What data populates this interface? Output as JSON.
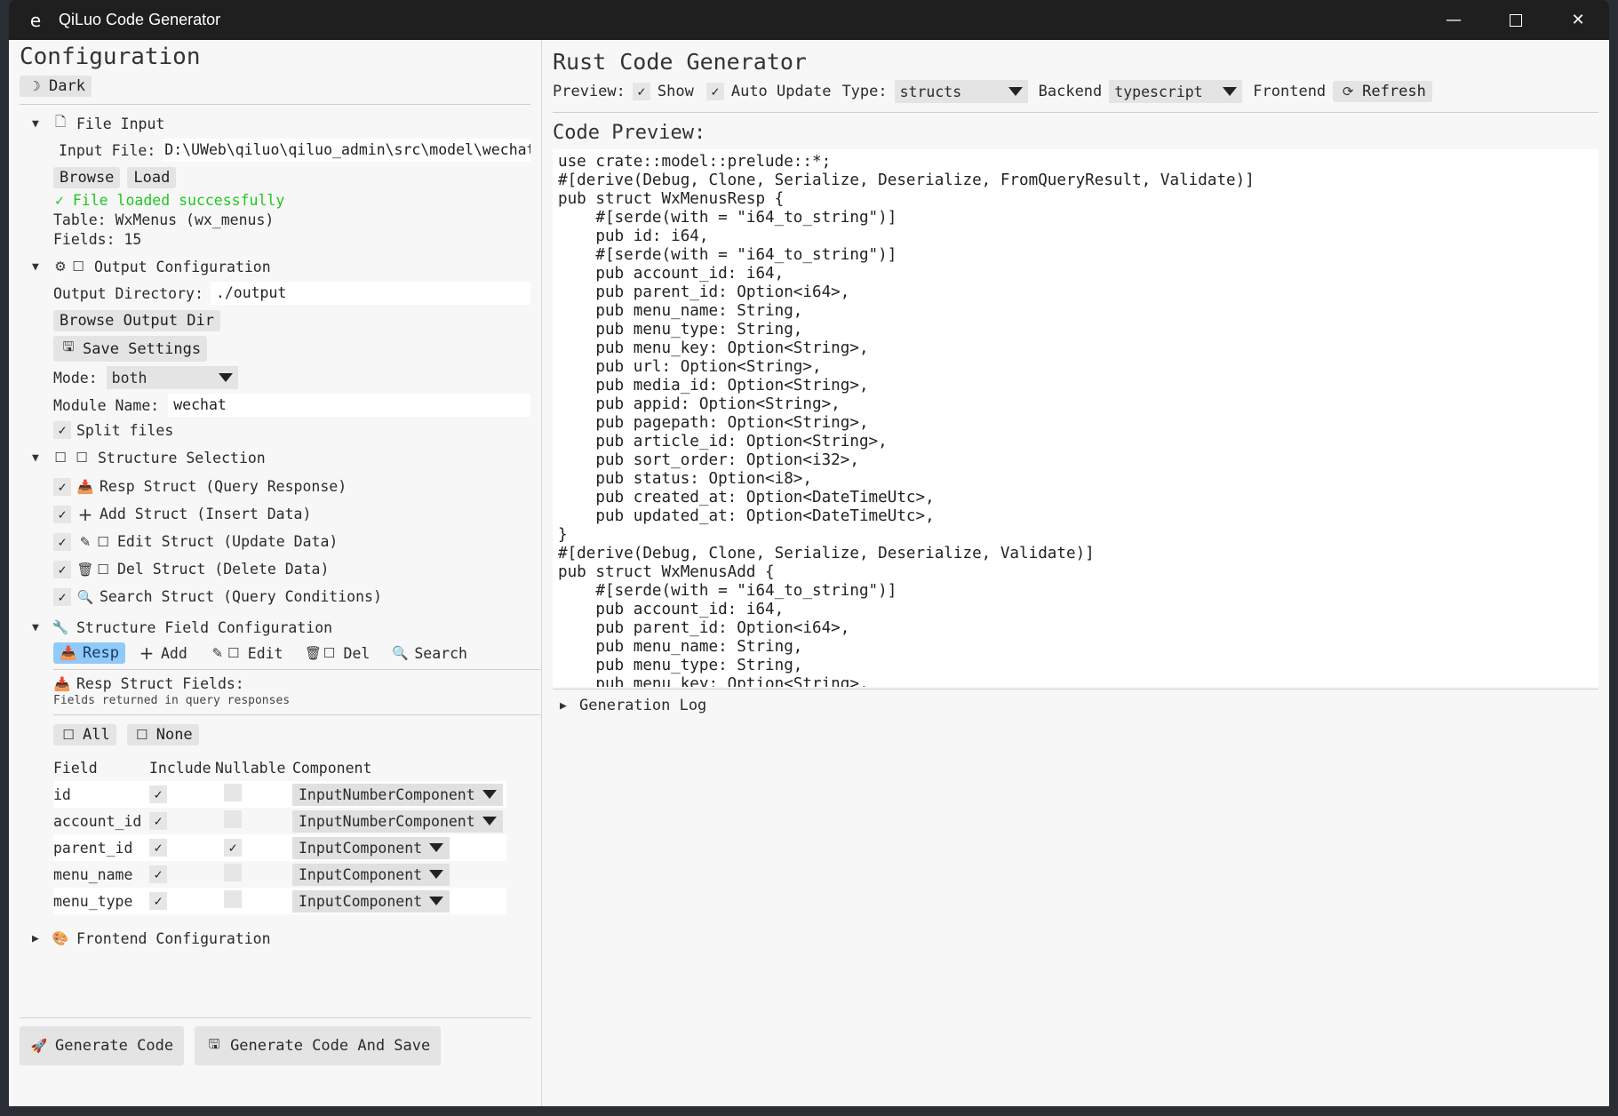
{
  "window": {
    "app_icon_letter": "e",
    "title": "QiLuo Code Generator"
  },
  "left": {
    "title": "Configuration",
    "theme_button": "Dark",
    "file_input": {
      "header": "File Input",
      "input_label": "Input File:",
      "input_value": "D:\\UWeb\\qiluo\\qiluo_admin\\src\\model\\wechat\\",
      "browse": "Browse",
      "load": "Load",
      "status": "✓ File loaded successfully",
      "table": "Table: WxMenus (wx_menus)",
      "fields": "Fields: 15"
    },
    "output_config": {
      "header": "Output Configuration",
      "dir_label": "Output Directory:",
      "dir_value": "./output",
      "browse_dir": "Browse Output Dir",
      "save_settings": "Save Settings",
      "mode_label": "Mode:",
      "mode_value": "both",
      "module_label": "Module Name:",
      "module_value": "wechat",
      "split_files": "Split files"
    },
    "structure_selection": {
      "header": "Structure Selection",
      "items": [
        {
          "label": "Resp Struct (Query Response)"
        },
        {
          "label": "Add Struct (Insert Data)"
        },
        {
          "label": "Edit Struct (Update Data)"
        },
        {
          "label": "Del Struct (Delete Data)"
        },
        {
          "label": "Search Struct (Query Conditions)"
        }
      ]
    },
    "field_config": {
      "header": "Structure Field Configuration",
      "tabs": [
        "Resp",
        "Add",
        "Edit",
        "Del",
        "Search"
      ],
      "active_tab": "Resp",
      "section_title": "Resp Struct Fields:",
      "section_desc": "Fields returned in query responses",
      "all": "All",
      "none": "None",
      "columns": [
        "Field",
        "Include",
        "Nullable",
        "Component"
      ],
      "rows": [
        {
          "field": "id",
          "include": "✓",
          "nullable": "",
          "component": "InputNumberComponent"
        },
        {
          "field": "account_id",
          "include": "✓",
          "nullable": "",
          "component": "InputNumberComponent"
        },
        {
          "field": "parent_id",
          "include": "✓",
          "nullable": "✓",
          "component": "InputComponent"
        },
        {
          "field": "menu_name",
          "include": "✓",
          "nullable": "",
          "component": "InputComponent"
        },
        {
          "field": "menu_type",
          "include": "✓",
          "nullable": "",
          "component": "InputComponent"
        }
      ]
    },
    "frontend_config": {
      "header": "Frontend Configuration"
    },
    "generate_code": "Generate Code",
    "generate_and_save": "Generate Code And Save"
  },
  "right": {
    "title": "Rust Code Generator",
    "preview_label": "Preview:",
    "show": "Show",
    "auto_update": "Auto Update",
    "type_label": "Type:",
    "type_value": "structs",
    "backend_label": "Backend",
    "backend_value": "typescript",
    "frontend_label": "Frontend",
    "refresh": "Refresh",
    "code_preview_title": "Code Preview:",
    "code": "use crate::model::prelude::*;\n#[derive(Debug, Clone, Serialize, Deserialize, FromQueryResult, Validate)]\npub struct WxMenusResp {\n    #[serde(with = \"i64_to_string\")]\n    pub id: i64,\n    #[serde(with = \"i64_to_string\")]\n    pub account_id: i64,\n    pub parent_id: Option<i64>,\n    pub menu_name: String,\n    pub menu_type: String,\n    pub menu_key: Option<String>,\n    pub url: Option<String>,\n    pub media_id: Option<String>,\n    pub appid: Option<String>,\n    pub pagepath: Option<String>,\n    pub article_id: Option<String>,\n    pub sort_order: Option<i32>,\n    pub status: Option<i8>,\n    pub created_at: Option<DateTimeUtc>,\n    pub updated_at: Option<DateTimeUtc>,\n}\n#[derive(Debug, Clone, Serialize, Deserialize, Validate)]\npub struct WxMenusAdd {\n    #[serde(with = \"i64_to_string\")]\n    pub account_id: i64,\n    pub parent_id: Option<i64>,\n    pub menu_name: String,\n    pub menu_type: String,\n    pub menu_key: Option<String>,",
    "generation_log": "Generation Log"
  }
}
